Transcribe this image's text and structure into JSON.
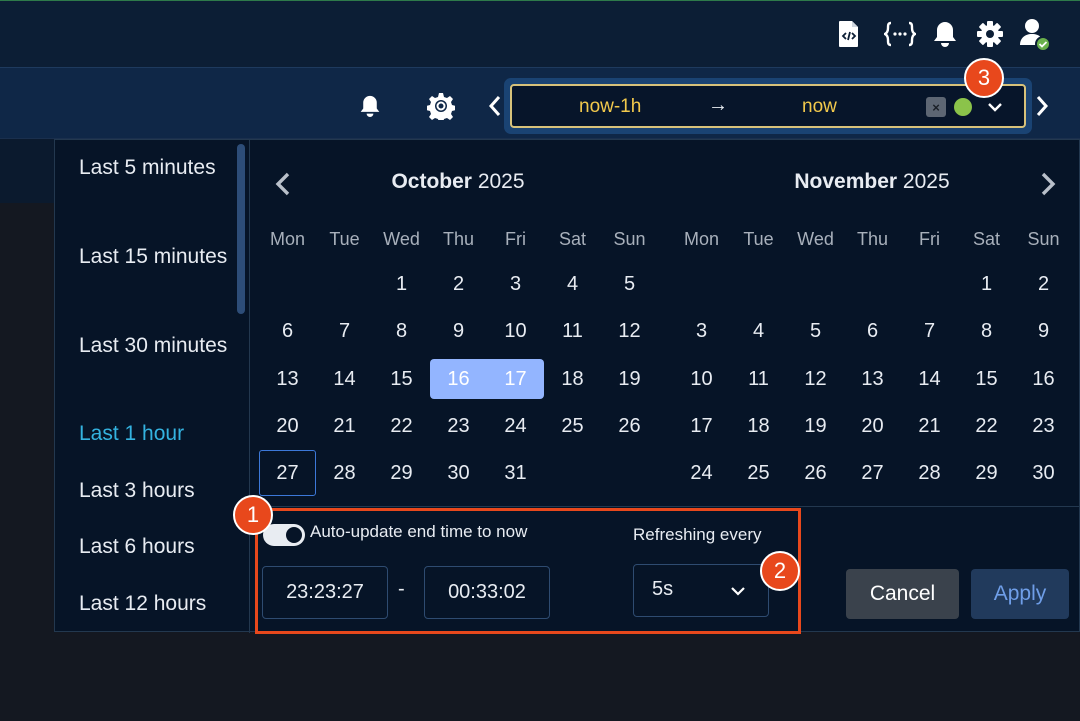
{
  "topbar": {
    "icons": [
      "code-file-icon",
      "json-braces-icon",
      "bell-icon",
      "gear-icon",
      "user-avatar-icon"
    ],
    "status_check": "check-icon"
  },
  "secondbar": {
    "icons": [
      "bell-icon",
      "settings-cog-icon"
    ]
  },
  "time_range": {
    "from": "now-1h",
    "arrow": "→",
    "to": "now",
    "clear": "×"
  },
  "badges": {
    "one": "1",
    "two": "2",
    "three": "3"
  },
  "presets": [
    {
      "label": "Last 5 minutes",
      "active": false
    },
    {
      "label": "Last 15 minutes",
      "active": false
    },
    {
      "label": "Last 30 minutes",
      "active": false
    },
    {
      "label": "Last 1 hour",
      "active": true
    },
    {
      "label": "Last 3 hours",
      "active": false
    },
    {
      "label": "Last 6 hours",
      "active": false
    },
    {
      "label": "Last 12 hours",
      "active": false
    }
  ],
  "calendar": {
    "weekdays": [
      "Mon",
      "Tue",
      "Wed",
      "Thu",
      "Fri",
      "Sat",
      "Sun"
    ],
    "months": [
      {
        "month": "October",
        "year": "2025",
        "weeks": [
          [
            "",
            "",
            "1",
            "2",
            "3",
            "4",
            "5"
          ],
          [
            "6",
            "7",
            "8",
            "9",
            "10",
            "11",
            "12"
          ],
          [
            "13",
            "14",
            "15",
            "16",
            "17",
            "18",
            "19"
          ],
          [
            "20",
            "21",
            "22",
            "23",
            "24",
            "25",
            "26"
          ],
          [
            "27",
            "28",
            "29",
            "30",
            "31",
            "",
            ""
          ]
        ],
        "selected": [
          "16",
          "17"
        ],
        "today": "27"
      },
      {
        "month": "November",
        "year": "2025",
        "weeks": [
          [
            "",
            "",
            "",
            "",
            "",
            "1",
            "2"
          ],
          [
            "3",
            "4",
            "5",
            "6",
            "7",
            "8",
            "9"
          ],
          [
            "10",
            "11",
            "12",
            "13",
            "14",
            "15",
            "16"
          ],
          [
            "17",
            "18",
            "19",
            "20",
            "21",
            "22",
            "23"
          ],
          [
            "24",
            "25",
            "26",
            "27",
            "28",
            "29",
            "30"
          ]
        ],
        "selected": [],
        "today": ""
      }
    ]
  },
  "footer": {
    "auto_update_label": "Auto-update end time to now",
    "auto_update_on": true,
    "start_time": "23:23:27",
    "separator": "-",
    "end_time": "00:33:02",
    "refresh_label": "Refreshing every",
    "refresh_value": "5s",
    "cancel_label": "Cancel",
    "apply_label": "Apply"
  },
  "colors": {
    "accent_yellow": "#f2c94c",
    "active_preset": "#34b3e0",
    "selected_day": "#93b5ff",
    "status_green": "#8bc34a",
    "badge_orange": "#e8481c"
  }
}
